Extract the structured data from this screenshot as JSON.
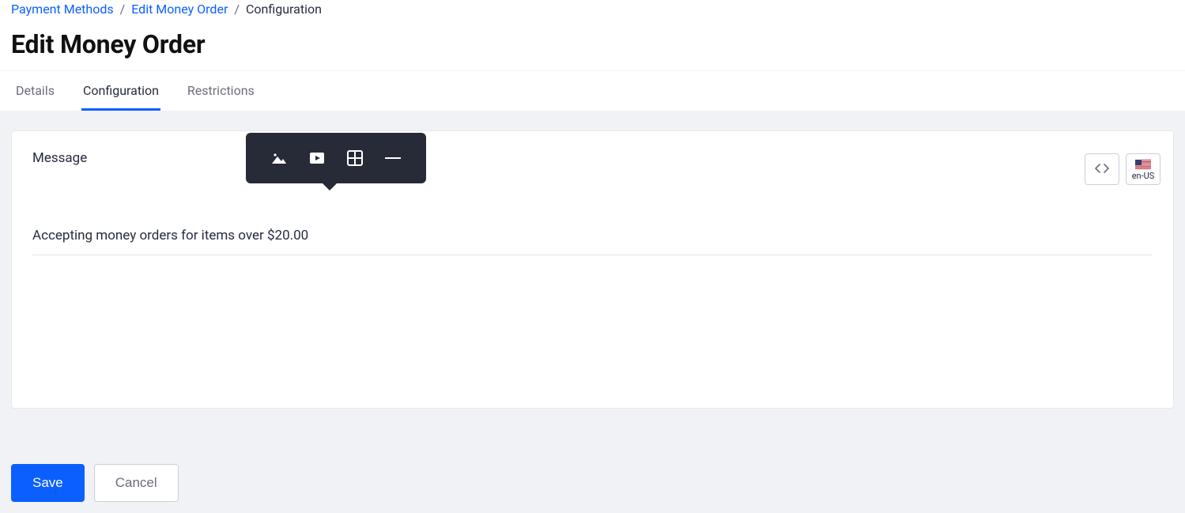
{
  "breadcrumb": {
    "items": [
      {
        "label": "Payment Methods",
        "current": false
      },
      {
        "label": "Edit Money Order",
        "current": false
      },
      {
        "label": "Configuration",
        "current": true
      }
    ],
    "separator": "/"
  },
  "page_title": "Edit Money Order",
  "tabs": [
    {
      "label": "Details",
      "active": false
    },
    {
      "label": "Configuration",
      "active": true
    },
    {
      "label": "Restrictions",
      "active": false
    }
  ],
  "editor": {
    "field_label": "Message",
    "content": "Accepting money orders for items over $20.00",
    "toolbar_icons": [
      "image-icon",
      "video-icon",
      "table-icon",
      "hr-icon"
    ],
    "source_button_icon": "code-icon",
    "locale_label": "en-US"
  },
  "actions": {
    "save_label": "Save",
    "cancel_label": "Cancel"
  },
  "colors": {
    "primary": "#0b5fff",
    "text": "#272b41",
    "muted": "#6b6c7e",
    "panel_bg": "#f1f2f5",
    "border": "#e7e7ed",
    "dark_popup": "#272b37"
  }
}
